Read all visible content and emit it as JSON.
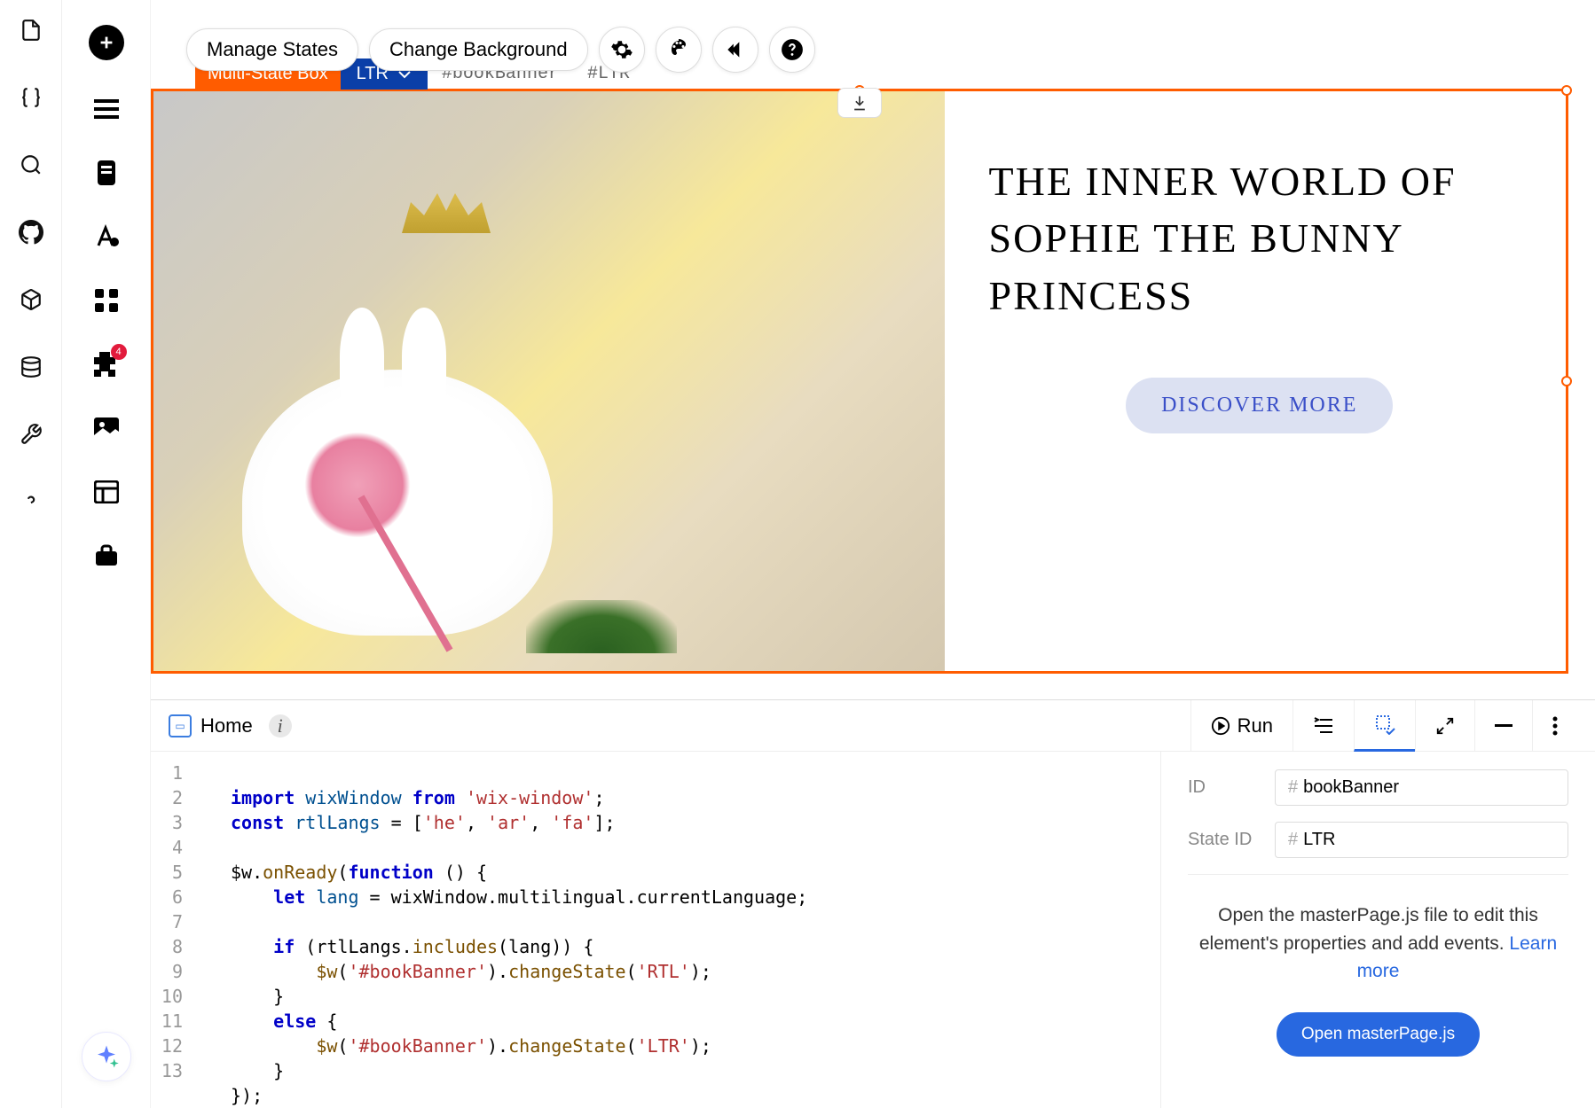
{
  "toolbar": {
    "manage_states": "Manage States",
    "change_background": "Change Background"
  },
  "element": {
    "type_label": "Multi-State Box",
    "state_label": "LTR",
    "id_tag": "#bookBanner",
    "state_tag": "#LTR"
  },
  "banner": {
    "title": "THE INNER WORLD OF SOPHIE THE BUNNY PRINCESS",
    "cta": "DISCOVER MORE"
  },
  "rail2": {
    "badge": "4"
  },
  "code_panel": {
    "file_name": "Home",
    "run_label": "Run",
    "lines": [
      "1",
      "2",
      "3",
      "4",
      "5",
      "6",
      "7",
      "8",
      "9",
      "10",
      "11",
      "12",
      "13"
    ]
  },
  "code": {
    "l1_import": "import",
    "l1_ident": "wixWindow",
    "l1_from": "from",
    "l1_str": "'wix-window'",
    "l1_semi": ";",
    "l2_const": "const",
    "l2_ident": "rtlLangs",
    "l2_eq": " = [",
    "l2_s1": "'he'",
    "l2_c1": ", ",
    "l2_s2": "'ar'",
    "l2_c2": ", ",
    "l2_s3": "'fa'",
    "l2_end": "];",
    "l4_a": "$w.",
    "l4_fn": "onReady",
    "l4_b": "(",
    "l4_kw": "function",
    "l4_c": " () {",
    "l5_a": "    ",
    "l5_kw": "let",
    "l5_b": " ",
    "l5_id": "lang",
    "l5_c": " = wixWindow.multilingual.currentLanguage;",
    "l7_a": "    ",
    "l7_kw": "if",
    "l7_b": " (rtlLangs.",
    "l7_fn": "includes",
    "l7_c": "(lang)) {",
    "l8_a": "        ",
    "l8_fn": "$w",
    "l8_b": "(",
    "l8_s": "'#bookBanner'",
    "l8_c": ").",
    "l8_fn2": "changeState",
    "l8_d": "(",
    "l8_s2": "'RTL'",
    "l8_e": ");",
    "l9": "    }",
    "l10_a": "    ",
    "l10_kw": "else",
    "l10_b": " {",
    "l11_a": "        ",
    "l11_fn": "$w",
    "l11_b": "(",
    "l11_s": "'#bookBanner'",
    "l11_c": ").",
    "l11_fn2": "changeState",
    "l11_d": "(",
    "l11_s2": "'LTR'",
    "l11_e": ");",
    "l12": "    }",
    "l13": "});"
  },
  "props": {
    "id_label": "ID",
    "id_value": "bookBanner",
    "state_id_label": "State ID",
    "state_id_value": "LTR",
    "msg_part1": "Open the masterPage.js file to edit this element's properties and add events. ",
    "learn_more": "Learn more",
    "open_button": "Open masterPage.js"
  }
}
